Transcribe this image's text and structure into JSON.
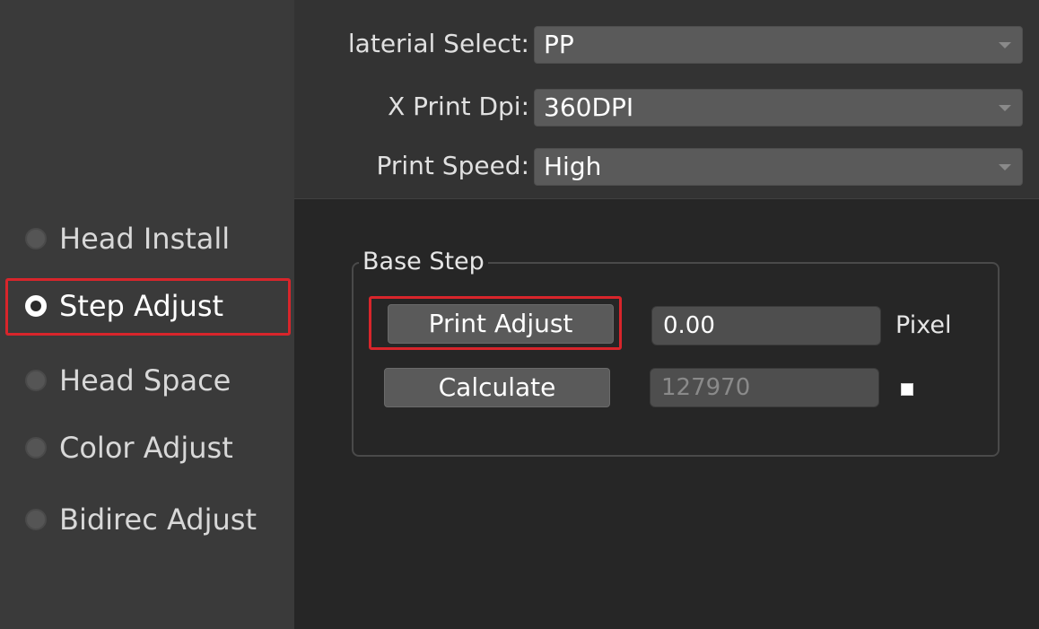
{
  "sidebar": {
    "items": [
      {
        "label": "Head Install",
        "checked": false
      },
      {
        "label": "Step Adjust",
        "checked": true
      },
      {
        "label": "Head Space",
        "checked": false
      },
      {
        "label": "Color Adjust",
        "checked": false
      },
      {
        "label": "Bidirec Adjust",
        "checked": false
      }
    ]
  },
  "settings": {
    "material": {
      "label": "laterial Select:",
      "value": "PP"
    },
    "dpi": {
      "label": "X Print Dpi:",
      "value": "360DPI"
    },
    "speed": {
      "label": "Print Speed:",
      "value": "High"
    }
  },
  "base_step": {
    "title": "Base Step",
    "print_adjust_label": "Print Adjust",
    "print_adjust_value": "0.00",
    "unit": "Pixel",
    "calculate_label": "Calculate",
    "calculate_value": "127970",
    "checkbox_checked": true
  },
  "colors": {
    "highlight": "#d8252b",
    "sidebar_bg": "#3a3a3a",
    "main_bg": "#262626"
  }
}
